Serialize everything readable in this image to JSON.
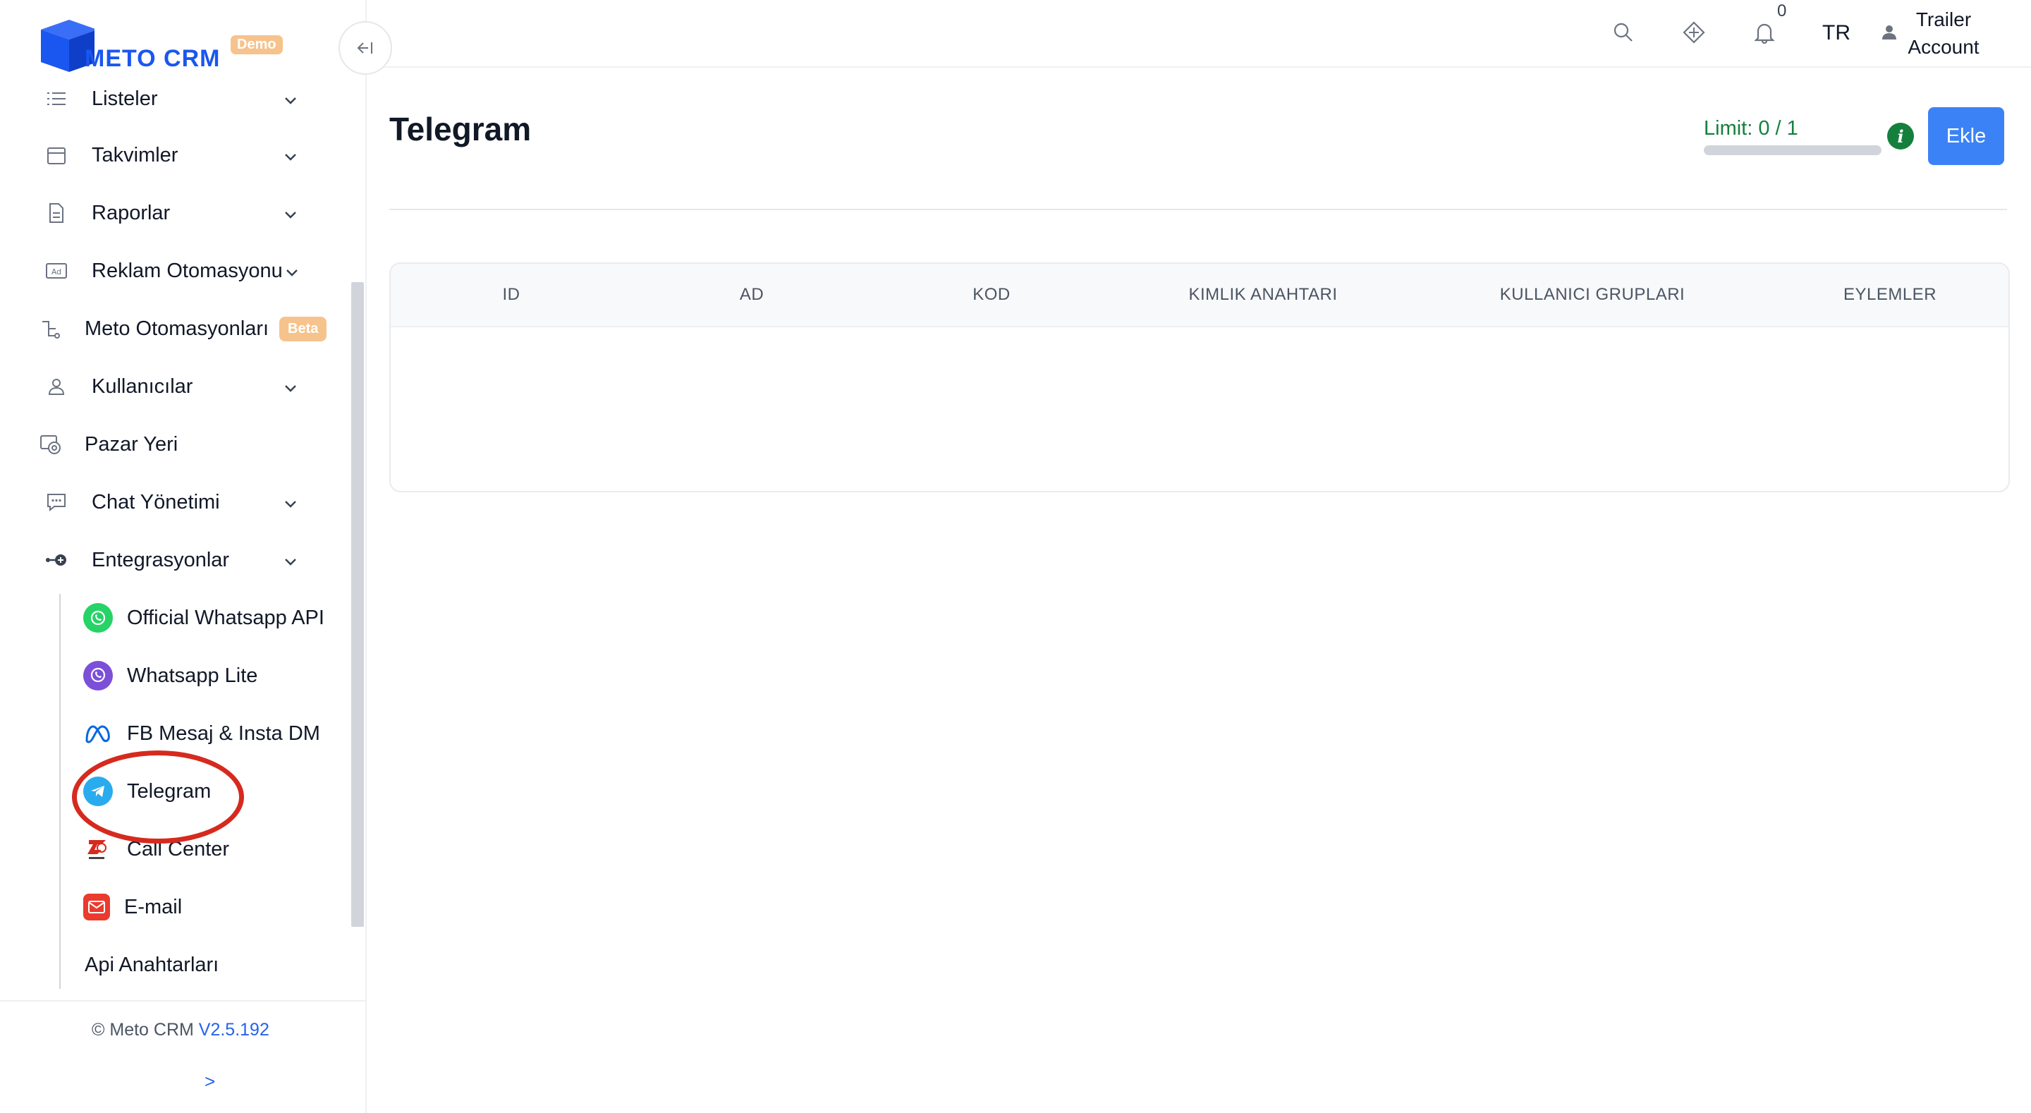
{
  "brand": {
    "name": "METO CRM",
    "badge": "Demo",
    "accent": "#1a56f0"
  },
  "sidebar": {
    "items": [
      {
        "label": "Listeler",
        "icon": "list-icon"
      },
      {
        "label": "Takvimler",
        "icon": "calendar-icon"
      },
      {
        "label": "Raporlar",
        "icon": "report-icon"
      },
      {
        "label": "Reklam Otomasyonu",
        "icon": "ad-icon"
      },
      {
        "label": "Meto Otomasyonları",
        "icon": "automation-icon",
        "badge": "Beta"
      },
      {
        "label": "Kullanıcılar",
        "icon": "user-icon"
      },
      {
        "label": "Pazar Yeri",
        "icon": "marketplace-icon"
      },
      {
        "label": "Chat Yönetimi",
        "icon": "chat-icon"
      },
      {
        "label": "Entegrasyonlar",
        "icon": "integration-icon"
      }
    ],
    "sub_items": [
      {
        "label": "Official Whatsapp API",
        "icon": "whatsapp-icon"
      },
      {
        "label": "Whatsapp Lite",
        "icon": "viber-icon"
      },
      {
        "label": "FB Mesaj & Insta DM",
        "icon": "meta-icon"
      },
      {
        "label": "Telegram",
        "icon": "telegram-icon"
      },
      {
        "label": "Call Center",
        "icon": "zadarma-icon"
      },
      {
        "label": "E-mail",
        "icon": "email-icon"
      },
      {
        "label": "Api Anahtarları",
        "icon": ""
      }
    ],
    "footer": {
      "copyright": "© Meto CRM",
      "version": "V2.5.192",
      "expand": ">"
    }
  },
  "topbar": {
    "notification_count": "0",
    "language": "TR",
    "account_line1": "Trailer",
    "account_line2": "Account"
  },
  "main": {
    "title": "Telegram",
    "limit_label": "Limit: 0 / 1",
    "limit_fraction": 0,
    "add_button": "Ekle",
    "table": {
      "columns": [
        "ID",
        "AD",
        "KOD",
        "KIMLIK ANAHTARI",
        "KULLANICI GRUPLARI",
        "EYLEMLER"
      ],
      "rows": []
    }
  }
}
